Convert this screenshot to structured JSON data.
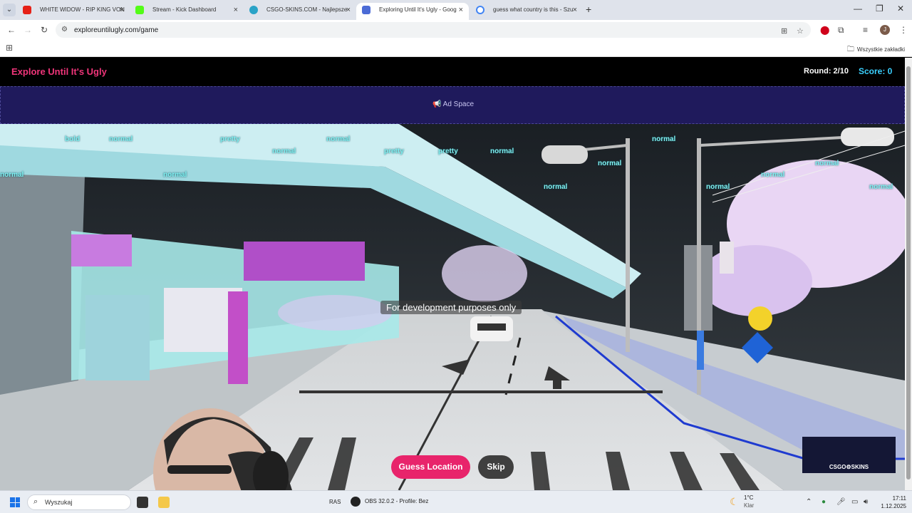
{
  "browser": {
    "tabs": [
      {
        "title": "WHITE WIDOW - RIP KING VON",
        "favicon_color": "#e62117",
        "active": false
      },
      {
        "title": "Stream - Kick Dashboard",
        "favicon_color": "#53fc18",
        "active": false
      },
      {
        "title": "CSGO-SKINS.COM - Najlepsze",
        "favicon_color": "#2aa3c7",
        "active": false
      },
      {
        "title": "Exploring Until It's Ugly - Goog",
        "favicon_color": "#4b6bd6",
        "active": true
      },
      {
        "title": "guess what country is this - Szu",
        "favicon_color": "#4285f4",
        "active": false
      }
    ],
    "url": "exploreuntilugly.com/game",
    "bookmarks_all_label": "Wszystkie zakładki"
  },
  "game": {
    "title": "Explore Until It's Ugly",
    "round": "Round: 2/10",
    "score": "Score: 0",
    "ad_label": "📢 Ad Space",
    "dev_note": "For development purposes only",
    "guess_button": "Guess Location",
    "skip_button": "Skip",
    "tags": [
      "bold",
      "normal",
      "pretty",
      "normal",
      "normal",
      "pretty",
      "pretty",
      "normal",
      "normal",
      "normal",
      "normal",
      "normal",
      "normal",
      "normal",
      "normal",
      "normal",
      "normal"
    ],
    "csgo_badge": "CSGO⚙SKINS"
  },
  "taskbar": {
    "search_placeholder": "Wyszukaj",
    "hidden_label": "RAS",
    "obs_label": "OBS 32.0.2 - Profile: Bez",
    "weather_temp": "1°C",
    "weather_desc": "Klar",
    "time": "17:11",
    "date": "1.12.2025"
  },
  "colors": {
    "title_pink": "#f0357a",
    "score_cyan": "#3ad0ff",
    "guess_button": "#e8246b",
    "ad_bg": "#1f1a5c"
  }
}
